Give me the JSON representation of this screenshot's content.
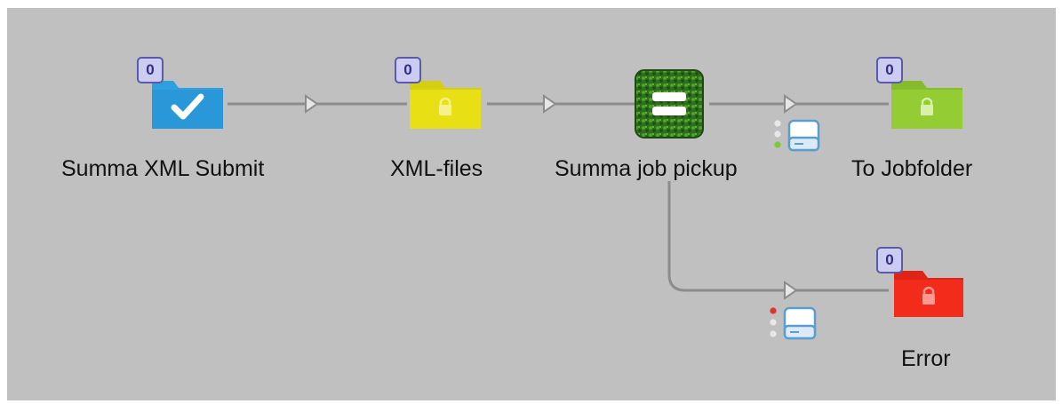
{
  "flow": {
    "nodes": [
      {
        "id": "summa-xml-submit",
        "label": "Summa XML Submit",
        "type": "submit-folder",
        "color": "#2e9fdf",
        "count": "0",
        "icon": "checkmark-icon"
      },
      {
        "id": "xml-files",
        "label": "XML-files",
        "type": "locked-folder",
        "color": "#e8e014",
        "count": "0",
        "icon": "lock-icon"
      },
      {
        "id": "summa-job-pickup",
        "label": "Summa job pickup",
        "type": "script-element",
        "color": "#2e7d1e",
        "icon": "equals-icon"
      },
      {
        "id": "to-jobfolder",
        "label": "To Jobfolder",
        "type": "locked-folder",
        "color": "#93cc33",
        "count": "0",
        "icon": "lock-icon"
      },
      {
        "id": "error",
        "label": "Error",
        "type": "locked-folder",
        "color": "#f32b1a",
        "count": "0",
        "icon": "lock-icon"
      }
    ],
    "connections": [
      {
        "from": "summa-xml-submit",
        "to": "xml-files"
      },
      {
        "from": "xml-files",
        "to": "summa-job-pickup"
      },
      {
        "from": "summa-job-pickup",
        "to": "to-jobfolder",
        "status": "success",
        "status_color": "#7ec832",
        "icon": "disk-drive-icon"
      },
      {
        "from": "summa-job-pickup",
        "to": "error",
        "status": "error",
        "status_color": "#e0332a",
        "icon": "disk-drive-icon"
      }
    ]
  }
}
